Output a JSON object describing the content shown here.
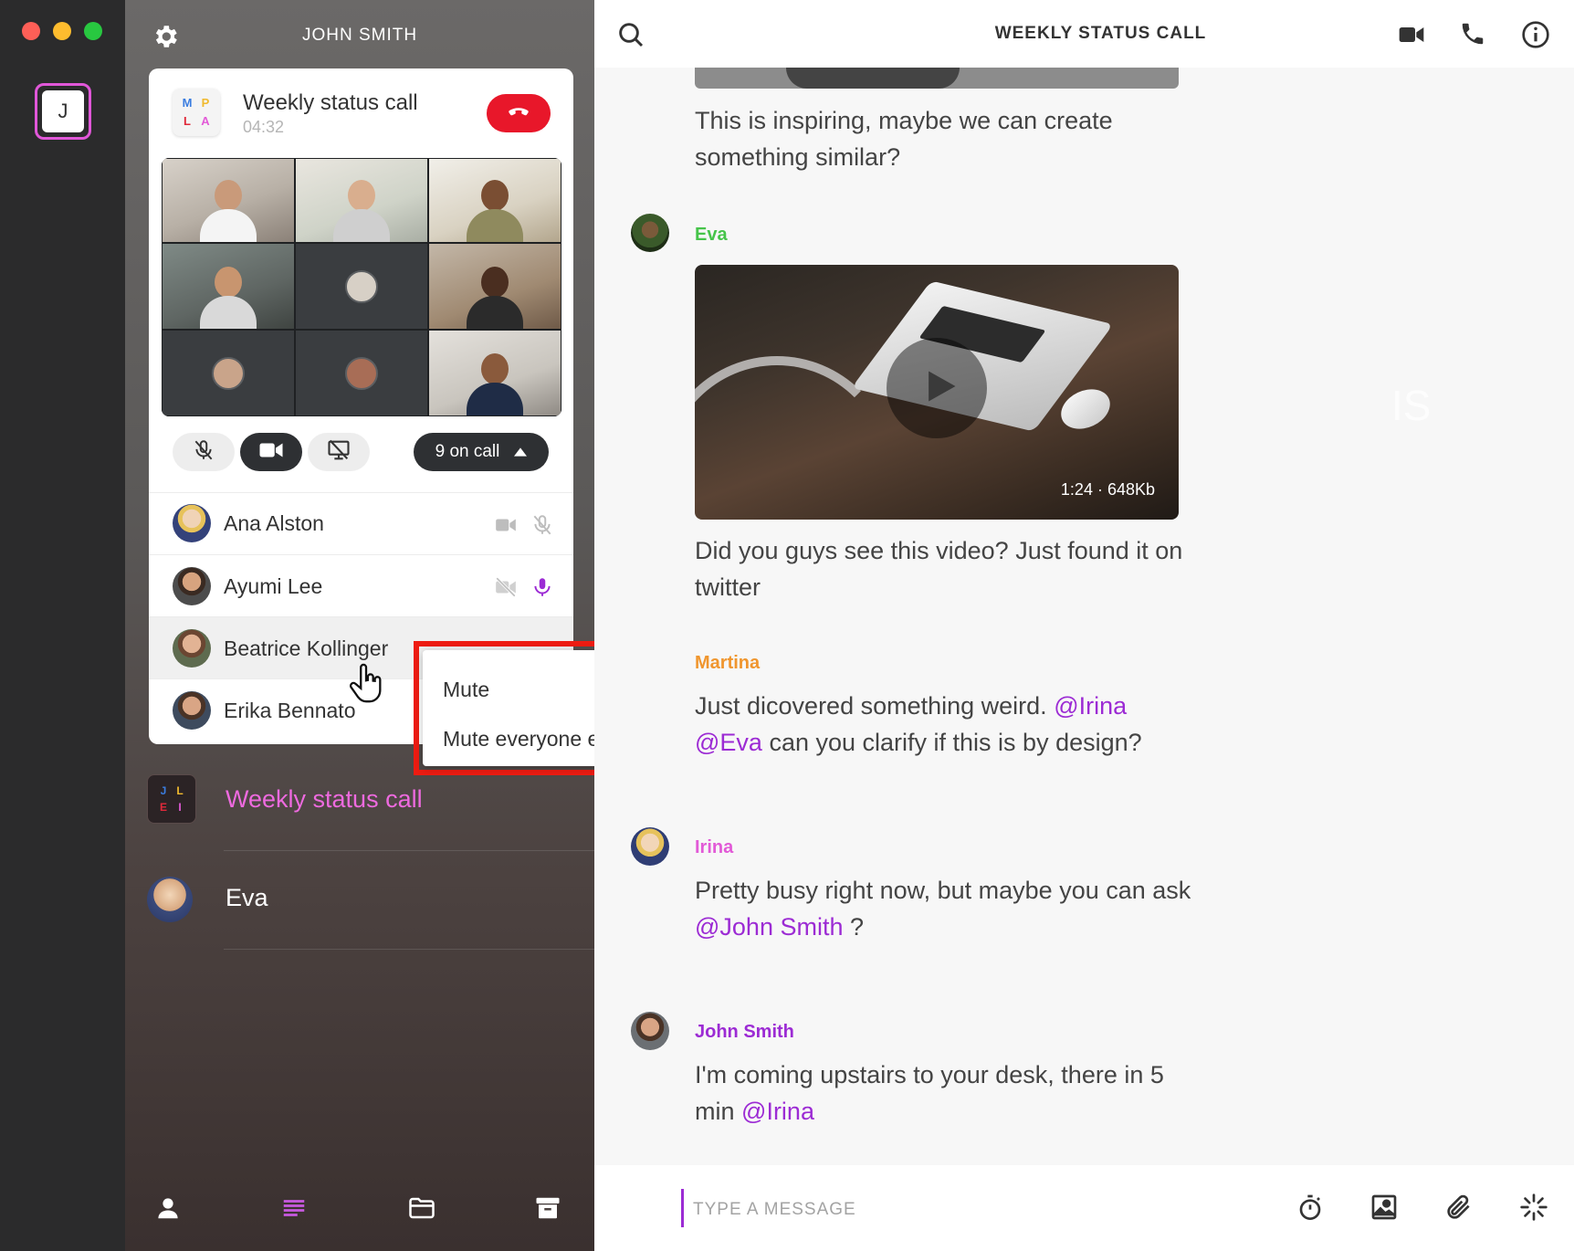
{
  "workspace": {
    "initial": "J"
  },
  "sidebar": {
    "title": "JOHN SMITH",
    "call": {
      "avatar_letters": [
        "M",
        "P",
        "L",
        "A"
      ],
      "title": "Weekly status call",
      "timer": "04:32",
      "on_call_label": "9 on call"
    },
    "participants": [
      {
        "name": "Ana Alston"
      },
      {
        "name": "Ayumi Lee"
      },
      {
        "name": "Beatrice Kollinger"
      },
      {
        "name": "Erika Bennato"
      }
    ],
    "context_menu": [
      "Mute",
      "Mute everyone else"
    ],
    "conversations": [
      {
        "name": "Weekly status call",
        "avatar_letters": [
          "J",
          "L",
          "E",
          "I"
        ]
      },
      {
        "name": "Eva"
      }
    ]
  },
  "main": {
    "title": "WEEKLY STATUS CALL",
    "messages": [
      {
        "text": "This is inspiring, maybe we can create something similar?"
      },
      {
        "sender": "Eva",
        "video_meta": "1:24 · 648Kb",
        "text": "Did you guys see this video? Just found it on twitter"
      },
      {
        "sender": "Martina",
        "text_before": "Just dicovered something weird.",
        "mention1": "@Irina",
        "mention2": "@Eva",
        "text_after": "can you clarify if this is by design?"
      },
      {
        "sender": "Irina",
        "text_before": "Pretty busy right now, but maybe you can ask",
        "mention": "@John Smith",
        "text_after": "?"
      },
      {
        "sender": "John Smith",
        "text_before": "I'm coming upstairs to your desk, there in 5 min",
        "mention": "@Irina"
      }
    ],
    "ghost_text": "IS",
    "composer": {
      "placeholder": "TYPE A MESSAGE"
    }
  },
  "colors": {
    "accent": "#9c2bd4",
    "hangup": "#e8172a",
    "highlight_box": "#ee1c12",
    "eva": "#46c44a",
    "martina": "#f0962e",
    "irina": "#e25ad7"
  },
  "icons": [
    "settings-gear-icon",
    "hangup-icon",
    "mic-off-icon",
    "video-camera-icon",
    "screen-share-off-icon",
    "caret-up-icon",
    "video-off-icon",
    "mic-icon",
    "pointer-hand-icon",
    "user-icon",
    "chat-list-icon",
    "folder-icon",
    "archive-icon",
    "search-icon",
    "phone-icon",
    "info-icon",
    "play-icon",
    "timer-icon",
    "image-icon",
    "attachment-icon",
    "sparkle-icon"
  ]
}
